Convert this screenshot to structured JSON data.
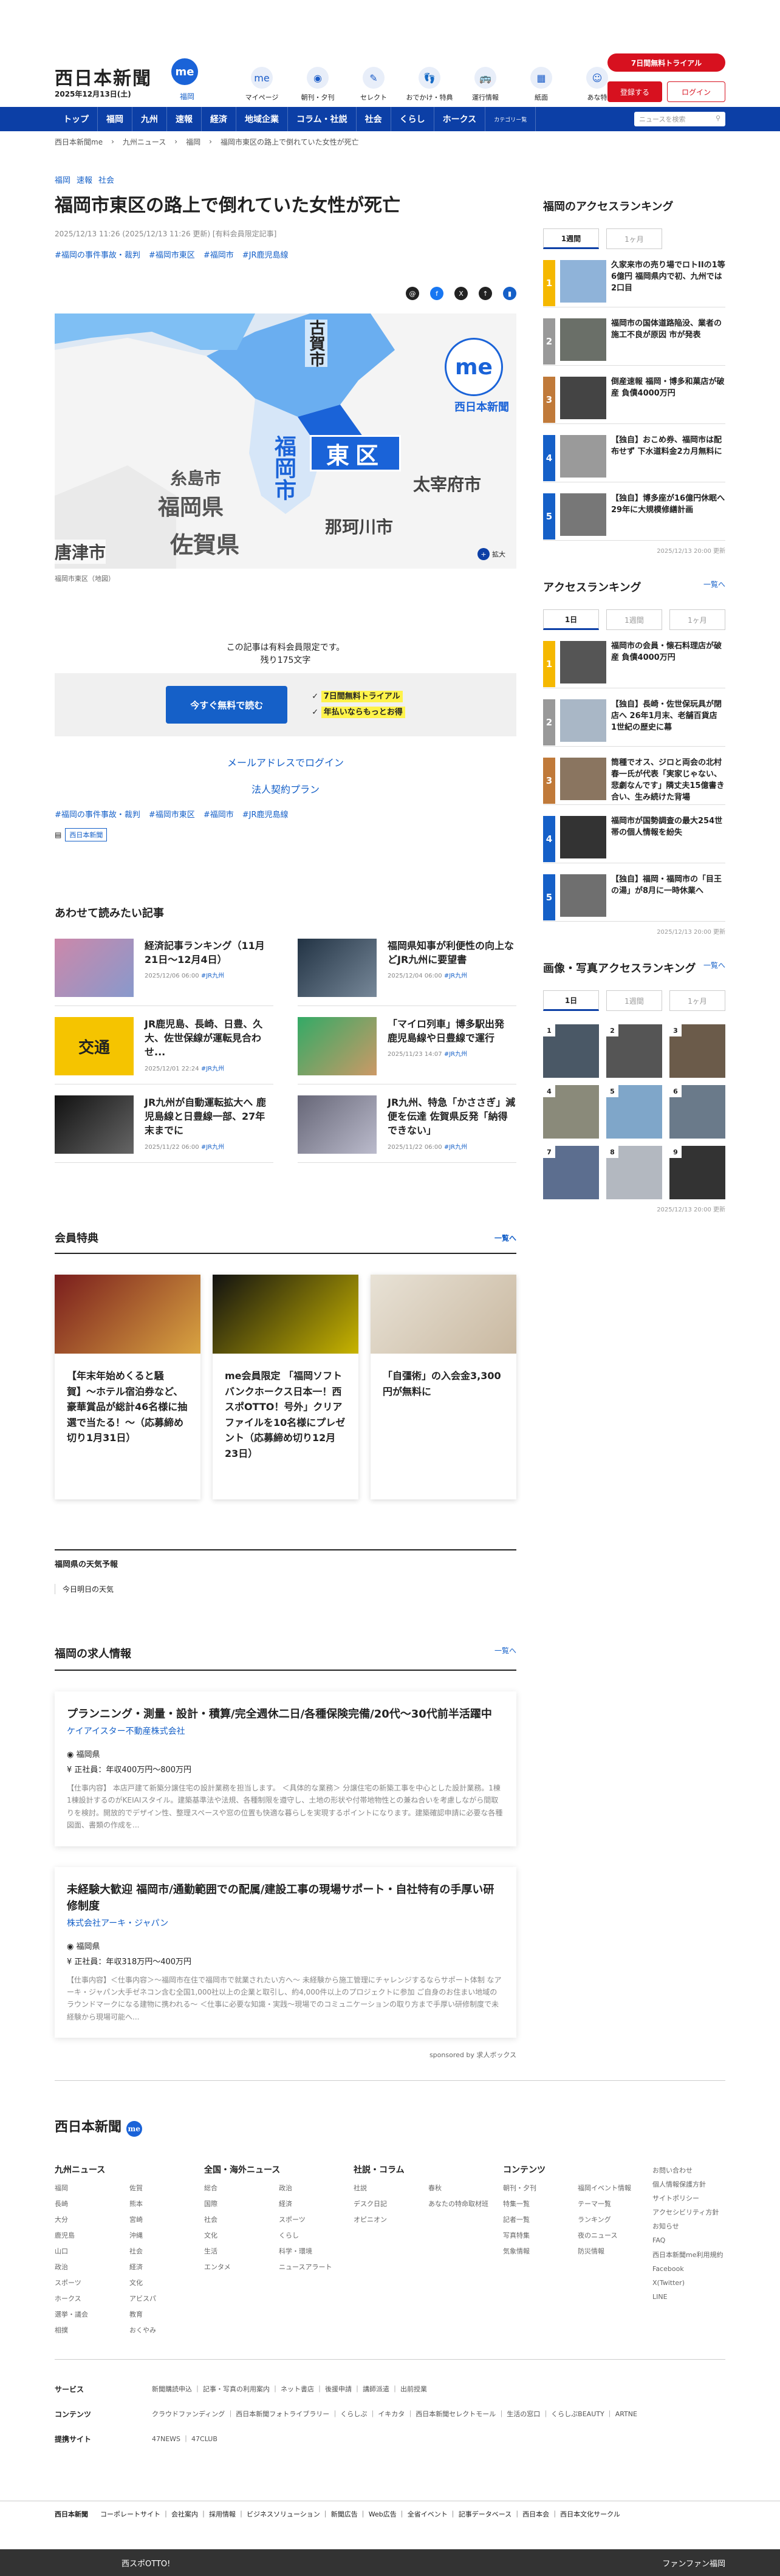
{
  "header": {
    "logo": "西日本新聞",
    "me": "me",
    "date": "2025年12月13日(土)",
    "region": "福岡",
    "icons": [
      {
        "label": "マイページ",
        "icon": "me"
      },
      {
        "label": "朝刊・夕刊",
        "icon": "◉"
      },
      {
        "label": "セレクト",
        "icon": "✎"
      },
      {
        "label": "おでかけ・特典",
        "icon": "👣"
      },
      {
        "label": "運行情報",
        "icon": "🚌"
      },
      {
        "label": "紙面",
        "icon": "▦"
      },
      {
        "label": "あな特",
        "icon": "☺"
      }
    ],
    "trial": "7日間無料トライアル",
    "register": "登録する",
    "login": "ログイン"
  },
  "nav": {
    "items": [
      "トップ",
      "福岡",
      "九州",
      "速報",
      "経済",
      "地域企業",
      "コラム・社説",
      "社会",
      "くらし",
      "ホークス"
    ],
    "category": "カテゴリー覧",
    "search_placeholder": "ニュースを検索"
  },
  "breadcrumb": [
    "西日本新聞me",
    "九州ニュース",
    "福岡",
    "福岡市東区の路上で倒れていた女性が死亡"
  ],
  "article": {
    "top_tags": [
      "福岡",
      "速報",
      "社会"
    ],
    "title": "福岡市東区の路上で倒れていた女性が死亡",
    "meta": "2025/12/13 11:26 (2025/12/13 11:26 更新) [有料会員限定記事]",
    "tags": [
      "#福岡の事件事故・裁判",
      "#福岡市東区",
      "#福岡市",
      "#JR鹿児島線"
    ],
    "map": {
      "brand": "西日本新聞",
      "east": "東区",
      "koga": "古賀市",
      "itoshima": "糸島市",
      "fukuoka_pref": "福岡県",
      "fukuoka_city": "福岡市",
      "dazaifu": "太宰府市",
      "nakagawa": "那珂川市",
      "saga": "佐賀県",
      "karatsu": "唐津市",
      "zoom": "拡大"
    },
    "caption": "福岡市東区（地図）",
    "paywall1": "この記事は有料会員限定です。",
    "paywall2": "残り175文字",
    "free_btn": "今すぐ無料で読む",
    "point1": "7日間無料トライアル",
    "point2": "年払いならもっとお得",
    "mail_login": "メールアドレスでログイン",
    "corp": "法人契約プラン",
    "source": "西日本新聞"
  },
  "related": {
    "title": "あわせて読みたい記事",
    "items": [
      {
        "title": "経済記事ランキング（11月21日〜12月4日）",
        "date": "2025/12/06 06:00",
        "tag": "#JR九州"
      },
      {
        "title": "福岡県知事が利便性の向上などJR九州に要望書",
        "date": "2025/12/04 06:00",
        "tag": "#JR九州"
      },
      {
        "title": "JR鹿児島、長崎、日豊、久大、佐世保線が運転見合わせ...",
        "date": "2025/12/01 22:24",
        "tag": "#JR九州"
      },
      {
        "title": "「マイロ列車」博多駅出発 鹿児島線や日豊線で運行",
        "date": "2025/11/23 14:07",
        "tag": "#JR九州"
      },
      {
        "title": "JR九州が自動運転拡大へ 鹿児島線と日豊線一部、27年末までに",
        "date": "2025/11/22 06:00",
        "tag": "#JR九州"
      },
      {
        "title": "JR九州、特急「かささぎ」減便を伝達 佐賀県反発「納得できない」",
        "date": "2025/11/22 06:00",
        "tag": "#JR九州"
      }
    ]
  },
  "benefits": {
    "title": "会員特典",
    "more": "一覧へ",
    "items": [
      "【年末年始めくると騒賀】〜ホテル宿泊券など、豪華賞品が総計46名様に抽選で当たる！〜（応募締め切り1月31日）",
      "me会員限定 「福岡ソフトバンクホークス日本一！西スポOTTO！号外」クリアファイルを10名様にプレゼント（応募締め切り12月23日）",
      "「自彊術」の入会金3,300円が無料に"
    ]
  },
  "weather": {
    "title": "福岡県の天気予報",
    "text": "今日明日の天気"
  },
  "jobs": {
    "title": "福岡の求人情報",
    "more": "一覧へ",
    "items": [
      {
        "title": "プランニング・測量・設計・積算/完全週休二日/各種保険完備/20代〜30代前半活躍中",
        "company": "ケイアイスター不動産株式会社",
        "loc": "福岡県",
        "salary": "正社員：年収400万円〜800万円",
        "desc": "【仕事内容】 本店戸建て新築分譲住宅の設計業務を担当します。 ＜具体的な業務＞ 分譲住宅の新築工事を中心とした設計業務。1棟1棟設計するのがKEIAIスタイル。建築基準法や法規、各種制限を遵守し、土地の形状や付帯地物性との兼ね合いを考慮しながら間取りを検討。開放的でデザイン性、整理スペースや窓の位置も快適な暮らしを実現するポイントになります。建築確認申請に必要な各種図面、書類の作成を..."
      },
      {
        "title": "未経験大歓迎 福岡市/通勤範囲での配属/建設工事の現場サポート・自社特有の手厚い研修制度",
        "company": "株式会社アーキ・ジャパン",
        "loc": "福岡県",
        "salary": "正社員：年収318万円〜400万円",
        "desc": "【仕事内容】＜仕事内容＞〜福岡市在住で福岡市で就業されたい方へ〜 未経験から施工管理にチャレンジするならサポート体制 なアーキ・ジャパン大手ゼネコン含む全国1,000社以上の企業と取引し、約4,000件以上のプロジェクトに参加 ご自身のお住まい地域のラウンドマークになる建物に携われる〜 ＜仕事に必要な知識・実践〜現場でのコミュニケーションの取り方まで手厚い研修制度で未経験から現場可能へ..."
      }
    ],
    "sponsor": "sponsored by 求人ボックス"
  },
  "side": {
    "fukuoka_rank": {
      "title": "福岡のアクセスランキング",
      "tabs": [
        "1週間",
        "1ヶ月"
      ],
      "items": [
        "久家来市の売り場でロトIIの1等6億円 福岡県内で初、九州では2口目",
        "福岡市の国体道路陥没、業者の施工不良が原因 市が発表",
        "倒産速報 福岡・博多和菓店が破産 負債4000万円",
        "【独自】おこめ券、福岡市は配布せず 下水道料金2カ月無料に",
        "【独自】博多座が16億円休眠へ29年に大規模修繕計画"
      ],
      "updated": "2025/12/13 20:00 更新"
    },
    "access_rank": {
      "title": "アクセスランキング",
      "more": "一覧へ",
      "tabs": [
        "1日",
        "1週間",
        "1ヶ月"
      ],
      "items": [
        "福岡市の会員・懐石料理店が破産 負債4000万円",
        "【独自】長崎・佐世保玩具が閉店へ 26年1月末、老舗百貨店 1世紀の歴史に幕",
        "筒種でオス、ジロと両会の北村春一氏が代表「実家じゃない、悲劇なんです」隣丈夫15億書き合い、生み続けた背場",
        "福岡市が国勢調査の最大254世帯の個人情報を紛失",
        "【独自】福岡・福岡市の「目王の湯」が8月に一時休業へ"
      ],
      "updated": "2025/12/13 20:00 更新"
    },
    "photo_rank": {
      "title": "画像・写真アクセスランキング",
      "more": "一覧へ",
      "tabs": [
        "1日",
        "1週間",
        "1ヶ月"
      ],
      "updated": "2025/12/13 20:00 更新"
    }
  },
  "footer": {
    "logo": "西日本新聞",
    "cols": [
      {
        "title": "九州ニュース",
        "items": [
          "福岡",
          "佐賀",
          "長崎",
          "熊本",
          "大分",
          "宮崎",
          "鹿児島",
          "沖縄",
          "山口",
          "社会",
          "政治",
          "経済",
          "スポーツ",
          "文化",
          "ホークス",
          "アビスパ",
          "選挙・議会",
          "教育",
          "相撲",
          "おくやみ"
        ]
      },
      {
        "title": "全国・海外ニュース",
        "items": [
          "総合",
          "政治",
          "国際",
          "経済",
          "社会",
          "スポーツ",
          "文化",
          "くらし",
          "生活",
          "科学・環境",
          "エンタメ",
          "ニュースアラート"
        ]
      },
      {
        "title": "社説・コラム",
        "items": [
          "社説",
          "春秋",
          "デスク日記",
          "あなたの特命取材班",
          "オピニオン"
        ]
      },
      {
        "title": "コンテンツ",
        "items": [
          "朝刊・夕刊",
          "福岡イベント情報",
          "特集一覧",
          "テーマ一覧",
          "記者一覧",
          "ランキング",
          "写真特集",
          "夜のニュース",
          "気象情報",
          "防災情報"
        ]
      }
    ],
    "last": [
      "お問い合わせ",
      "個人情報保護方針",
      "サイトポリシー",
      "アクセシビリティ方針",
      "お知らせ",
      "FAQ",
      "西日本新聞me利用規約",
      "Facebook",
      "X(Twitter)",
      "LINE"
    ],
    "rows": [
      {
        "label": "サービス",
        "text": "新聞購読申込 ｜ 記事・写真の利用案内 ｜ ネット書店 ｜ 後援申請 ｜ 講師派遣 ｜ 出前授業"
      },
      {
        "label": "コンテンツ",
        "text": "クラウドファンディング ｜ 西日本新聞フォトライブラリー ｜ くらしぷ ｜ イキカタ ｜ 西日本新聞セレクトモール ｜ 生活の窓口 ｜ くらしぷBEAUTY ｜ ARTNE"
      },
      {
        "label": "提携サイト",
        "text": "47NEWS ｜ 47CLUB"
      }
    ],
    "bottom": "コーポレートサイト ｜ 会社案内 ｜ 採用情報 ｜ ビジネスソリューション ｜ 新聞広告 ｜ Web広告 ｜ 全省イベント ｜ 記事データベース ｜ 西日本会 ｜ 西日本文化サークル",
    "ad_left": "西スポOTTO!",
    "ad_right": "ファンファン福岡"
  }
}
